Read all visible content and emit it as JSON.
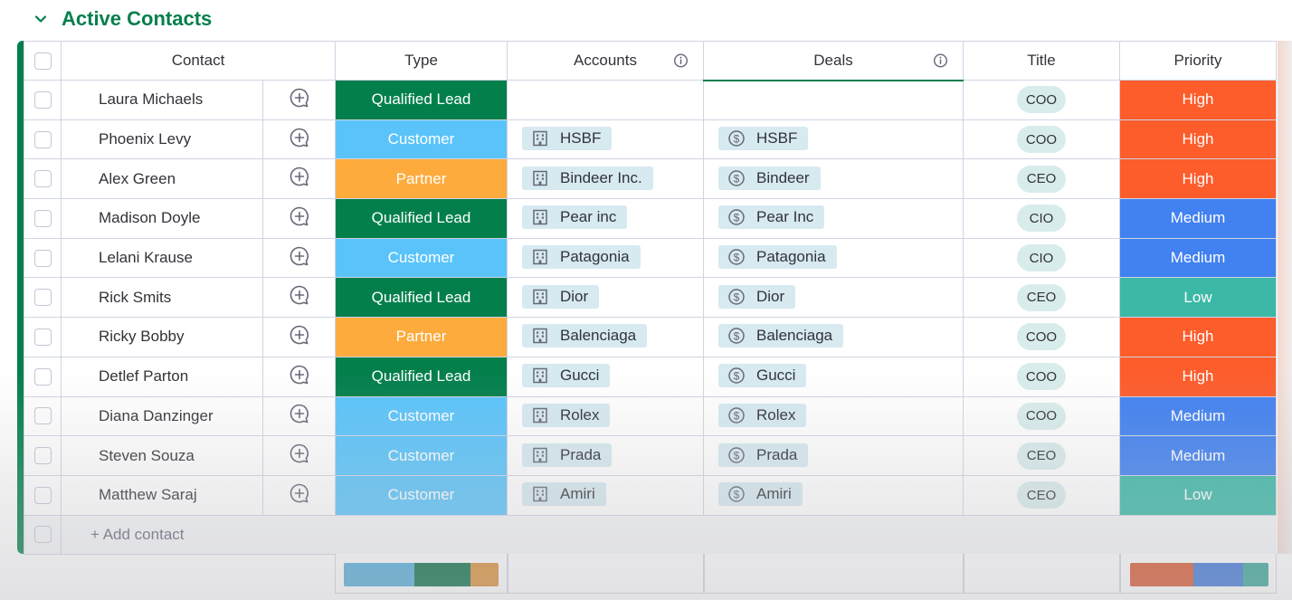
{
  "group": {
    "title": "Active Contacts"
  },
  "columns": {
    "contact": "Contact",
    "type": "Type",
    "accounts": "Accounts",
    "deals": "Deals",
    "title": "Title",
    "priority": "Priority"
  },
  "rows": [
    {
      "name": "Laura Michaels",
      "type": "Qualified Lead",
      "account": "",
      "deal": "",
      "title": "COO",
      "priority": "High"
    },
    {
      "name": "Phoenix Levy",
      "type": "Customer",
      "account": "HSBF",
      "deal": "HSBF",
      "title": "COO",
      "priority": "High"
    },
    {
      "name": "Alex Green",
      "type": "Partner",
      "account": "Bindeer Inc.",
      "deal": "Bindeer",
      "title": "CEO",
      "priority": "High"
    },
    {
      "name": "Madison Doyle",
      "type": "Qualified Lead",
      "account": "Pear inc",
      "deal": "Pear Inc",
      "title": "CIO",
      "priority": "Medium"
    },
    {
      "name": "Lelani Krause",
      "type": "Customer",
      "account": "Patagonia",
      "deal": "Patagonia",
      "title": "CIO",
      "priority": "Medium"
    },
    {
      "name": "Rick Smits",
      "type": "Qualified Lead",
      "account": "Dior",
      "deal": "Dior",
      "title": "CEO",
      "priority": "Low"
    },
    {
      "name": "Ricky Bobby",
      "type": "Partner",
      "account": "Balenciaga",
      "deal": "Balenciaga",
      "title": "COO",
      "priority": "High"
    },
    {
      "name": "Detlef Parton",
      "type": "Qualified Lead",
      "account": "Gucci",
      "deal": "Gucci",
      "title": "COO",
      "priority": "High"
    },
    {
      "name": "Diana Danzinger",
      "type": "Customer",
      "account": "Rolex",
      "deal": "Rolex",
      "title": "COO",
      "priority": "Medium"
    },
    {
      "name": "Steven Souza",
      "type": "Customer",
      "account": "Prada",
      "deal": "Prada",
      "title": "CEO",
      "priority": "Medium"
    },
    {
      "name": "Matthew Saraj",
      "type": "Customer",
      "account": "Amiri",
      "deal": "Amiri",
      "title": "CEO",
      "priority": "Low"
    }
  ],
  "add_contact": "+ Add contact",
  "type_colors": {
    "Qualified Lead": "#037f4c",
    "Customer": "#5ac4fa",
    "Partner": "#fdab3d"
  },
  "priority_colors": {
    "High": "#fd5c2b",
    "Medium": "#4181f0",
    "Low": "#3bb8a6"
  },
  "summary": {
    "type_distribution": [
      {
        "label": "Customer",
        "fraction": 0.455,
        "color": "#4eaad8"
      },
      {
        "label": "Qualified Lead",
        "fraction": 0.364,
        "color": "#016b40"
      },
      {
        "label": "Partner",
        "fraction": 0.182,
        "color": "#d98c31"
      }
    ],
    "priority_distribution": [
      {
        "label": "High",
        "fraction": 0.455,
        "color": "#d9522a"
      },
      {
        "label": "Medium",
        "fraction": 0.364,
        "color": "#3b74d6"
      },
      {
        "label": "Low",
        "fraction": 0.182,
        "color": "#34a394"
      }
    ]
  },
  "icons": {
    "group_toggle": "chevron-down-icon",
    "add_update": "add-update-icon",
    "account_chip": "building-icon",
    "deal_chip": "dollar-icon",
    "column_info": "info-icon"
  }
}
